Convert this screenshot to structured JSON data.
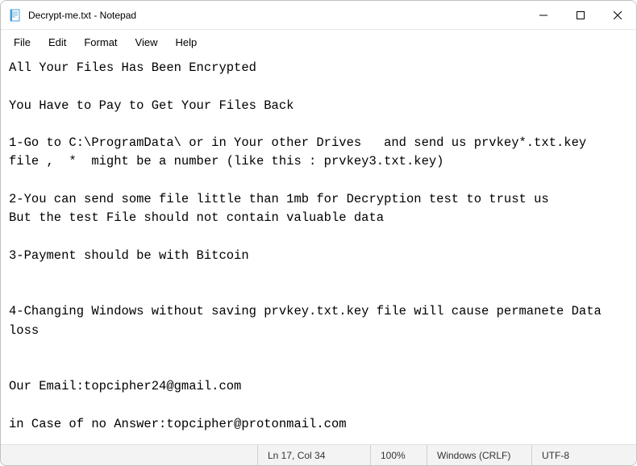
{
  "window": {
    "title": "Decrypt-me.txt - Notepad",
    "icon_name": "notepad-icon"
  },
  "menu": {
    "items": [
      "File",
      "Edit",
      "Format",
      "View",
      "Help"
    ]
  },
  "content": "All Your Files Has Been Encrypted\n\nYou Have to Pay to Get Your Files Back\n\n1-Go to C:\\ProgramData\\ or in Your other Drives   and send us prvkey*.txt.key  file ,  *  might be a number (like this : prvkey3.txt.key)\n\n2-You can send some file little than 1mb for Decryption test to trust us\nBut the test File should not contain valuable data\n\n3-Payment should be with Bitcoin\n\n\n4-Changing Windows without saving prvkey.txt.key file will cause permanete Data loss\n\n\nOur Email:topcipher24@gmail.com\n\nin Case of no Answer:topcipher@protonmail.com",
  "statusbar": {
    "position": "Ln 17, Col 34",
    "zoom": "100%",
    "line_ending": "Windows (CRLF)",
    "encoding": "UTF-8"
  }
}
